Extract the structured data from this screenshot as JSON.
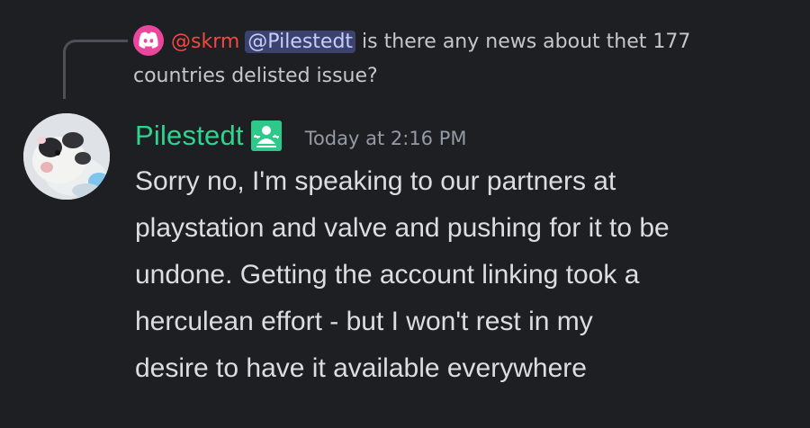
{
  "reply": {
    "author": "@skrm",
    "mention": "@Pilestedt",
    "text_line1": " is there any news about thet 177",
    "text_line2": "countries delisted issue?",
    "avatar_icon": "discord-logo-icon",
    "avatar_color": "#eb459e"
  },
  "message": {
    "author": "Pilestedt",
    "author_color": "#2dd490",
    "role_icon": "moderator-role-icon",
    "timestamp": "Today at 2:16 PM",
    "content_lines": [
      "Sorry no, I'm speaking to our partners at",
      "playstation and valve and pushing for it to be",
      "undone. Getting the account linking took a",
      "herculean effort - but I won't rest in my",
      "desire to have it available everywhere"
    ]
  }
}
